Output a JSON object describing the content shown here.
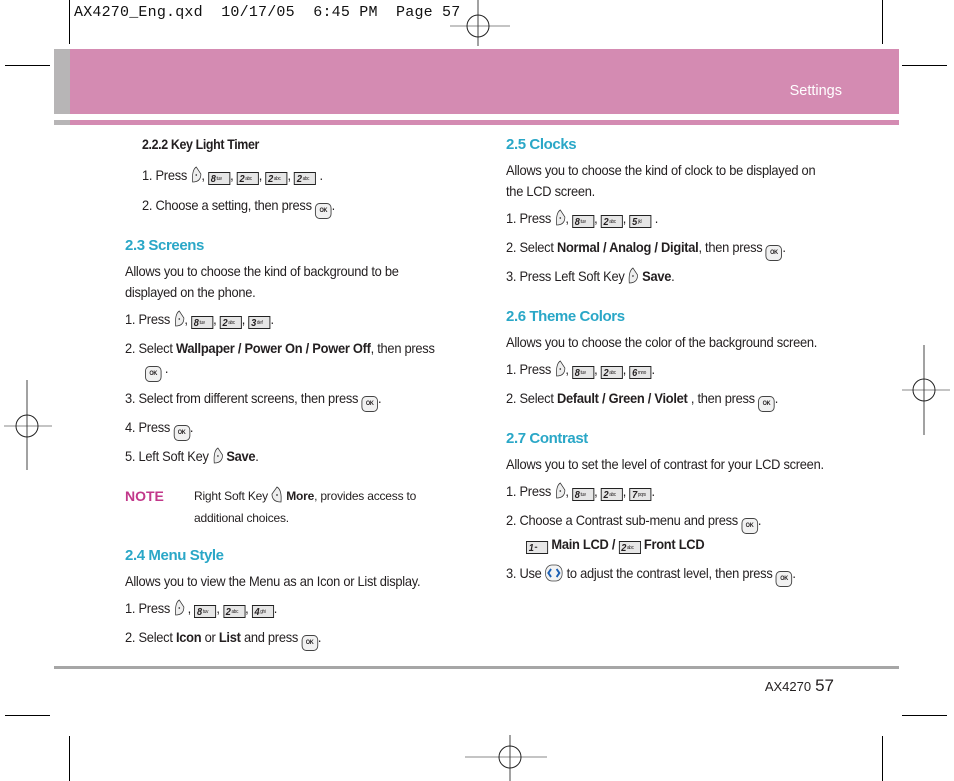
{
  "slug": "AX4270_Eng.qxd  10/17/05  6:45 PM  Page 57",
  "header": {
    "section": "Settings"
  },
  "footer": {
    "model": "AX4270",
    "page": "57"
  },
  "colors": {
    "heading": "#2aa7c7",
    "band": "#d48bb2",
    "band_grey": "#b7b5b6",
    "note": "#c2378a",
    "rule": "#a6a6a6"
  },
  "keys": {
    "k8": "8",
    "k8s": "tuv",
    "k2": "2",
    "k2s": "abc",
    "k3": "3",
    "k3s": "def",
    "k4": "4",
    "k4s": "ghi",
    "k5": "5",
    "k5s": "jkl",
    "k6": "6",
    "k6s": "mno",
    "k7": "7",
    "k7s": "pqrs",
    "k1": "1",
    "k1s": "••",
    "ok": "OK"
  },
  "left": {
    "s222": {
      "title": "2.2.2 Key Light Timer",
      "step1": "1.  Press",
      "step2": "2.  Choose a setting, then press"
    },
    "s23": {
      "title": "2.3 Screens",
      "desc1": "Allows  you  to  choose  the  kind  of  background  to  be",
      "desc2": "displayed on the phone.",
      "step1": "1.  Press",
      "step2_a": "2.  Select ",
      "step2_b": "Wallpaper",
      "step2_c": " / ",
      "step2_d": "Power On",
      "step2_e": " / ",
      "step2_f": "Power Off",
      "step2_g": ", then press",
      "step3": "3.  Select from different screens, then press",
      "step4": "4.  Press",
      "step5_a": "5.  Left Soft Key",
      "step5_b": "Save"
    },
    "note": {
      "label": "NOTE",
      "text_a": "Right Soft Key",
      "text_b": "More",
      "text_c": ", provides access to",
      "text_d": "additional choices."
    },
    "s24": {
      "title": "2.4 Menu Style",
      "desc": "Allows you to view the Menu as an Icon or List display.",
      "step1": "1.  Press",
      "step2_a": "2.  Select ",
      "step2_b": "Icon",
      "step2_c": " or ",
      "step2_d": "List",
      "step2_e": " and press"
    }
  },
  "right": {
    "s25": {
      "title": "2.5 Clocks",
      "desc1": "Allows you to choose the kind of clock to be displayed on",
      "desc2": "the LCD screen.",
      "step1": "1.  Press",
      "step2_a": "2.  Select ",
      "step2_b": "Normal",
      "step2_c": " / ",
      "step2_d": "Analog",
      "step2_e": " / ",
      "step2_f": "Digital",
      "step2_g": ", then press",
      "step3_a": "3.  Press Left Soft Key",
      "step3_b": "Save"
    },
    "s26": {
      "title": "2.6 Theme Colors",
      "desc": "Allows you to choose the color of the background screen.",
      "step1": "1.  Press",
      "step2_a": "2.  Select ",
      "step2_b": "Default",
      "step2_c": " / ",
      "step2_d": "Green",
      "step2_e": " / ",
      "step2_f": "Violet",
      "step2_g": " , then press"
    },
    "s27": {
      "title": "2.7 Contrast",
      "desc": "Allows you to set the level of contrast for your LCD screen.",
      "step1": "1.  Press",
      "step2": "2.  Choose a Contrast sub-menu and press",
      "opt1": "Main LCD",
      "opt_sep": " / ",
      "opt2": "Front LCD",
      "step3_a": "3.  Use",
      "step3_b": "to adjust the contrast level, then press"
    }
  }
}
